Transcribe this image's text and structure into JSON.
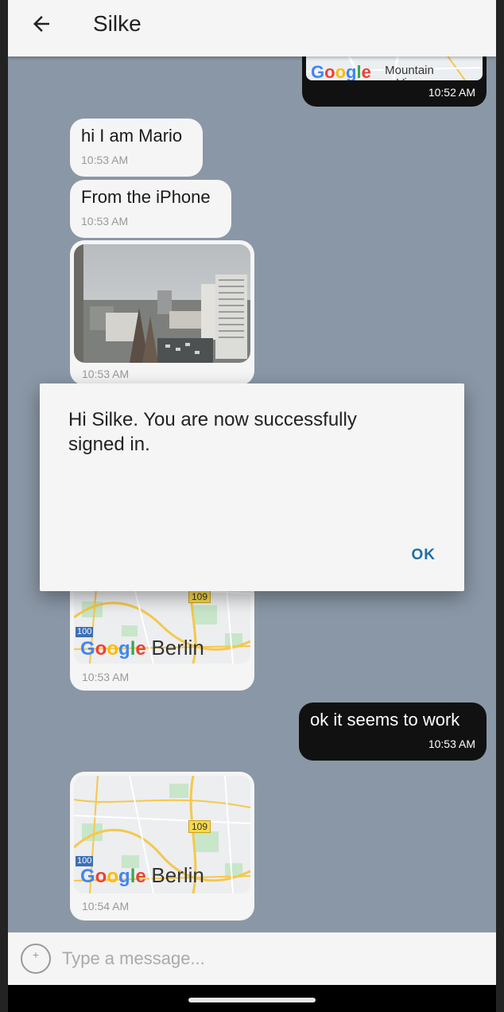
{
  "header": {
    "title": "Silke"
  },
  "messages": [
    {
      "type": "map",
      "direction": "out",
      "place": "Mountain View",
      "time": "10:52 AM"
    },
    {
      "type": "text",
      "direction": "in",
      "text": "hi I am Mario",
      "time": "10:53 AM"
    },
    {
      "type": "text",
      "direction": "in",
      "text": "From the iPhone",
      "time": "10:53 AM"
    },
    {
      "type": "photo",
      "direction": "in",
      "time": "10:53 AM"
    },
    {
      "type": "map",
      "direction": "in",
      "place": "Berlin",
      "road_label": "109",
      "road_label_2": "100",
      "time": "10:53 AM"
    },
    {
      "type": "text",
      "direction": "out",
      "text": "ok it seems to work",
      "time": "10:53 AM"
    },
    {
      "type": "map",
      "direction": "in",
      "place": "Berlin",
      "road_label": "109",
      "road_label_2": "100",
      "time": "10:54 AM"
    }
  ],
  "map_brand": {
    "text": "Google",
    "colors": [
      "#4285F4",
      "#EA4335",
      "#FBBC05",
      "#4285F4",
      "#34A853",
      "#EA4335"
    ]
  },
  "composer": {
    "placeholder": "Type a message..."
  },
  "dialog": {
    "message": "Hi Silke. You are now successfully signed in.",
    "ok_label": "OK"
  },
  "colors": {
    "chat_background": "#8a97a6",
    "outgoing_bubble": "#111111",
    "incoming_bubble": "#f5f5f5",
    "dialog_button": "#1f6fa3"
  }
}
